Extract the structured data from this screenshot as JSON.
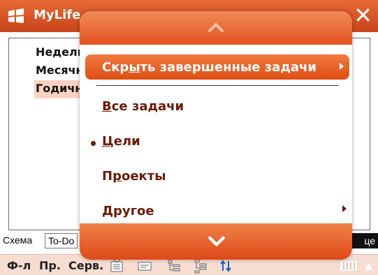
{
  "titlebar": {
    "app_title": "MyLife",
    "close_glyph": "✕"
  },
  "list": {
    "items": [
      {
        "label": "Недель",
        "selected": false
      },
      {
        "label": "Месячн",
        "selected": false
      },
      {
        "label": "Годичн",
        "selected": true
      }
    ]
  },
  "tabs": {
    "schema": "Схема",
    "todo": "To-Do",
    "last": "це"
  },
  "bottombar": {
    "menu": [
      "Ф-л",
      "Пр.",
      "Серв."
    ],
    "icons": [
      "task-list-icon",
      "card-icon",
      "tree-outline-icon",
      "tree-indent-icon",
      "sort-arrows-icon"
    ]
  },
  "popup": {
    "items": [
      {
        "label": "Скрыть завершенные задачи",
        "highlighted": true,
        "submenu": true
      },
      {
        "label": "Все задачи",
        "highlighted": false,
        "submenu": false
      },
      {
        "label": "Цели",
        "highlighted": false,
        "submenu": false,
        "checked": true
      },
      {
        "label": "Проекты",
        "highlighted": false,
        "submenu": false
      },
      {
        "label": "Другое",
        "highlighted": false,
        "submenu": true
      }
    ]
  },
  "colors": {
    "accent": "#e2521f",
    "menu_text": "#6b1a08",
    "selection": "#fbd2c2"
  }
}
